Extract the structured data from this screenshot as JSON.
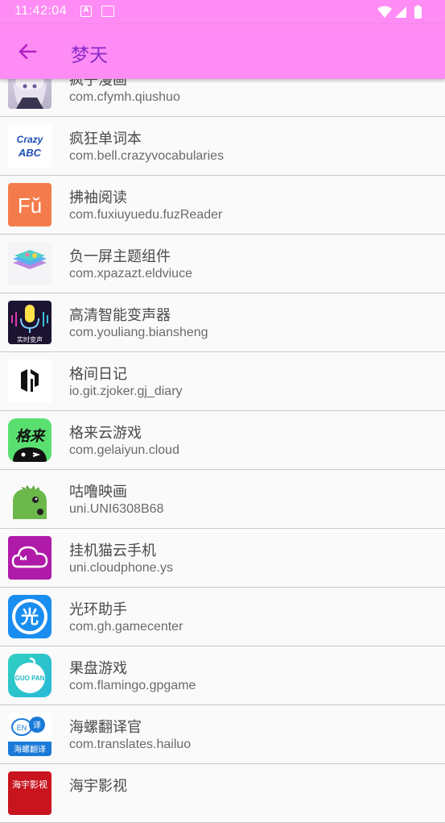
{
  "status_bar": {
    "time": "11:42:04",
    "a_icon": "A"
  },
  "toolbar": {
    "title": "梦天"
  },
  "apps": [
    {
      "name": "疯子漫画",
      "package": "com.cfymh.qiushuo",
      "icon": "anime-girl-icon"
    },
    {
      "name": "疯狂单词本",
      "package": "com.bell.crazyvocabularies",
      "icon": "crazy-abc-icon",
      "icon_text": [
        "Crazy",
        "ABC"
      ]
    },
    {
      "name": "拂袖阅读",
      "package": "com.fuxiuyuedu.fuzReader",
      "icon": "fu-reader-icon",
      "icon_text": "Fŭ"
    },
    {
      "name": "负一屏主题组件",
      "package": "com.xpazazt.eldviuce",
      "icon": "layers-icon"
    },
    {
      "name": "高清智能变声器",
      "package": "com.youliang.biansheng",
      "icon": "microphone-icon",
      "icon_text": "实时变声"
    },
    {
      "name": "格间日记",
      "package": "io.git.zjoker.gj_diary",
      "icon": "diary-logo-icon"
    },
    {
      "name": "格来云游戏",
      "package": "com.gelaiyun.cloud",
      "icon": "gelai-icon",
      "icon_text": "格来"
    },
    {
      "name": "咕噜映画",
      "package": "uni.UNI6308B68",
      "icon": "green-creature-icon"
    },
    {
      "name": "挂机猫云手机",
      "package": "uni.cloudphone.ys",
      "icon": "cloud-cat-icon"
    },
    {
      "name": "光环助手",
      "package": "com.gh.gamecenter",
      "icon": "halo-icon",
      "icon_text": "光"
    },
    {
      "name": "果盘游戏",
      "package": "com.flamingo.gpgame",
      "icon": "guopan-icon",
      "icon_text": "GUO PAN"
    },
    {
      "name": "海螺翻译官",
      "package": "com.translates.hailuo",
      "icon": "translate-bubble-icon",
      "icon_text": [
        "EN",
        "译",
        "海螺翻译"
      ]
    },
    {
      "name": "海宇影视",
      "package": "",
      "icon": "film-icon",
      "icon_text": "海宇影视"
    }
  ]
}
